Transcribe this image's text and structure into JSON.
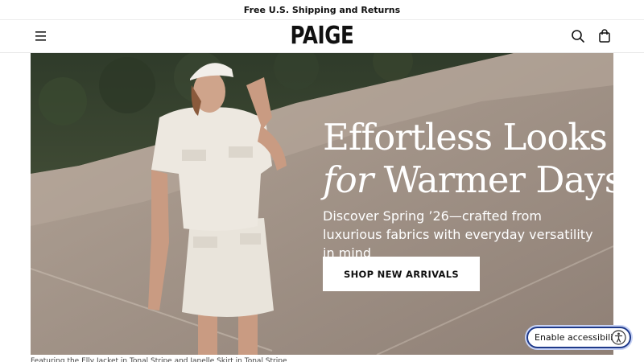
{
  "promo": {
    "text": "Free U.S. Shipping and Returns"
  },
  "header": {
    "logo": "PAIGE",
    "icons": {
      "menu": "hamburger-menu-icon",
      "search": "search-icon",
      "bag": "shopping-bag-icon"
    }
  },
  "hero": {
    "title_line1": "Effortless Looks",
    "title_italic": "for",
    "title_line2_rest": " Warmer Days",
    "subtitle": "Discover Spring ’26—crafted from luxurious fabrics with everyday versatility in mind",
    "cta_label": "SHOP NEW ARRIVALS",
    "caption": "Featuring the Elly Jacket in Tonal Stripe and Janelle Skirt in Tonal Stripe"
  },
  "accessibility": {
    "label": "Enable accessibility",
    "icon": "accessibility-person-icon"
  },
  "colors": {
    "accent": "#1f3a8a",
    "cta_bg": "#ffffff",
    "text": "#111111"
  }
}
